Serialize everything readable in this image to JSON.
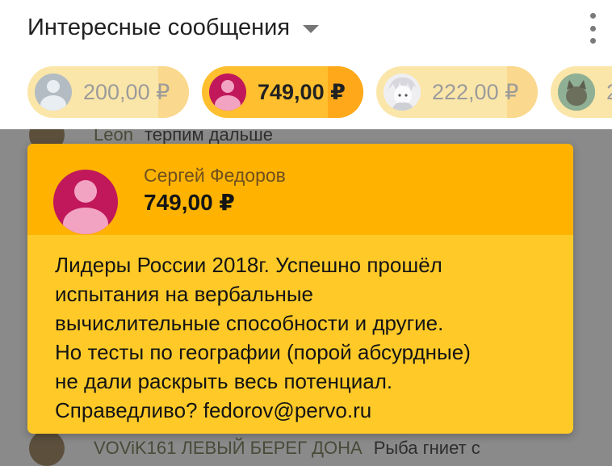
{
  "header": {
    "title": "Интересные сообщения",
    "dropdown_icon": "caret-down-icon",
    "menu_icon": "more-vert-icon"
  },
  "chips": [
    {
      "amount": "200,00 ₽",
      "avatar": "default-person",
      "active": false
    },
    {
      "amount": "749,00 ₽",
      "avatar": "default-person",
      "active": true
    },
    {
      "amount": "222,00 ₽",
      "avatar": "anime-portrait",
      "active": false
    },
    {
      "amount": "2",
      "avatar": "cat-photo",
      "active": false
    }
  ],
  "background_chat": [
    {
      "author": "Leon",
      "text": "терпим дальше"
    },
    {
      "author": "VOViK161 ЛЕВЫЙ БЕРЕГ ДОНА",
      "text": "Рыба гниет с"
    }
  ],
  "card": {
    "name": "Сергей Федоров",
    "amount": "749,00 ₽",
    "message": "Лидеры России 2018г. Успешно прошёл\nиспытания на вербальные\nвычислительные способности и другие.\nНо тесты по географии (порой абсурдные)\nне дали раскрыть весь потенциал.\nСправедливо? fedorov@pervo.ru"
  },
  "colors": {
    "overlay": "#8a8a8a",
    "card_body": "#ffca28",
    "card_header": "#ffb300",
    "chip_active": "#ffbf2f",
    "chip_dim": "#fbe6a9",
    "avatar_red": "#c0185b"
  }
}
